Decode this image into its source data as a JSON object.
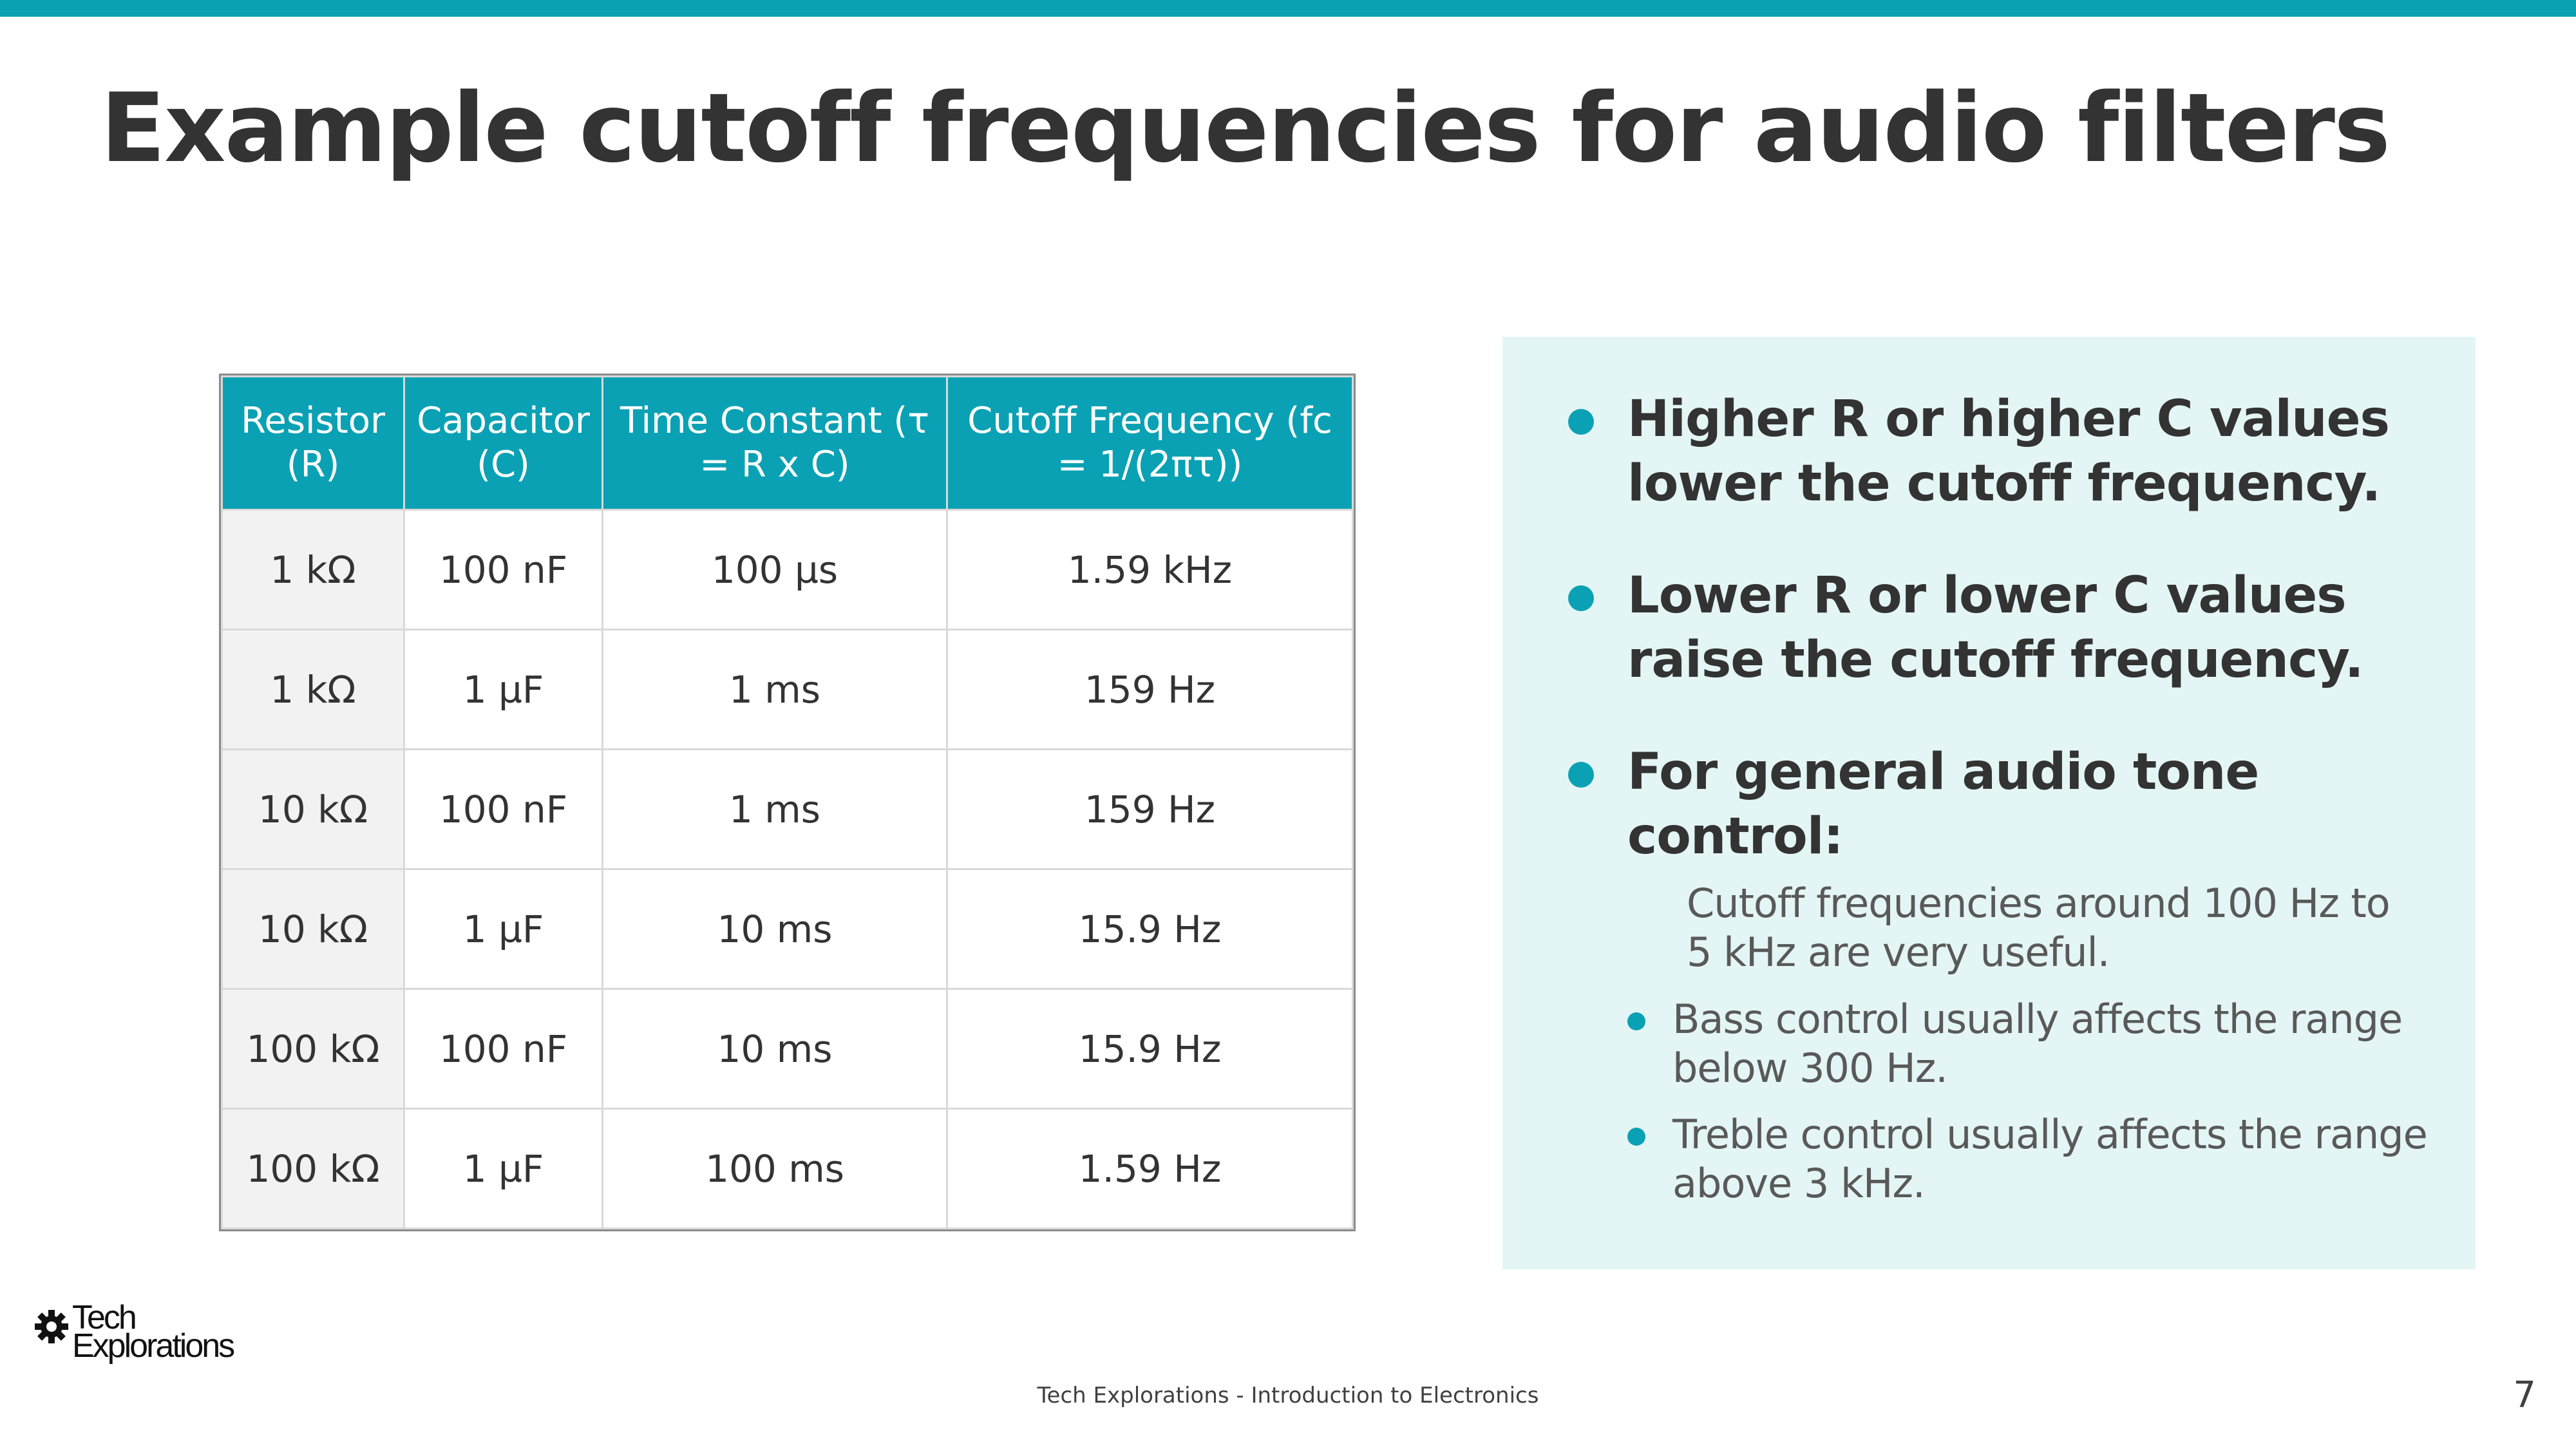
{
  "title": "Example cutoff frequencies for audio filters",
  "table": {
    "headers": [
      "Resistor (R)",
      "Capacitor (C)",
      "Time Constant (τ = R x C)",
      "Cutoff Frequency (fc = 1/(2πτ))"
    ],
    "rows": [
      [
        "1 kΩ",
        "100 nF",
        "100 µs",
        "1.59 kHz"
      ],
      [
        "1 kΩ",
        "1 µF",
        "1 ms",
        "159 Hz"
      ],
      [
        "10 kΩ",
        "100 nF",
        "1 ms",
        "159 Hz"
      ],
      [
        "10 kΩ",
        "1 µF",
        "10 ms",
        "15.9 Hz"
      ],
      [
        "100 kΩ",
        "100 nF",
        "10 ms",
        "15.9 Hz"
      ],
      [
        "100 kΩ",
        "1 µF",
        "100 ms",
        "1.59 Hz"
      ]
    ]
  },
  "notes": {
    "points": [
      "Higher R or higher C values lower the cutoff frequency.",
      "Lower R or lower C values raise the cutoff frequency.",
      "For general audio tone control:"
    ],
    "sub_intro": "Cutoff frequencies around 100 Hz to 5 kHz are very useful.",
    "sub_points": [
      "Bass control usually affects the range below 300 Hz.",
      "Treble control usually affects the range above 3 kHz."
    ]
  },
  "logo": {
    "line1": "Tech",
    "line2": "Explorations",
    "icon": "gear-icon"
  },
  "footer": {
    "text": "Tech Explorations - Introduction to Electronics",
    "page_number": "7"
  },
  "colors": {
    "accent": "#0aa1b4",
    "panel": "#e4f5f6",
    "text": "#333333"
  }
}
